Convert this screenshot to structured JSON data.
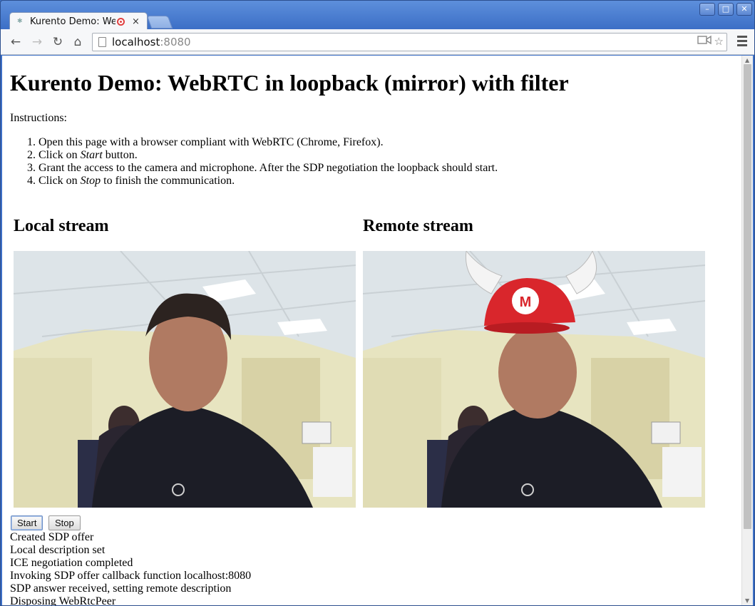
{
  "browser": {
    "tab_title": "Kurento Demo: We",
    "tab_close": "×",
    "url_host": "localhost",
    "url_port": ":8080"
  },
  "page": {
    "heading": "Kurento Demo: WebRTC in loopback (mirror) with filter",
    "instructions_label": "Instructions:",
    "steps": [
      {
        "pre": "Open this page with a browser compliant with WebRTC (Chrome, Firefox).",
        "em": "",
        "post": ""
      },
      {
        "pre": "Click on ",
        "em": "Start",
        "post": " button."
      },
      {
        "pre": "Grant the access to the camera and microphone. After the SDP negotiation the loopback should start.",
        "em": "",
        "post": ""
      },
      {
        "pre": "Click on ",
        "em": "Stop",
        "post": " to finish the communication."
      }
    ],
    "local_stream_heading": "Local stream",
    "remote_stream_heading": "Remote stream",
    "start_label": "Start",
    "stop_label": "Stop",
    "log": [
      "Created SDP offer",
      "Local description set",
      "ICE negotiation completed",
      "Invoking SDP offer callback function localhost:8080",
      "SDP answer received, setting remote description",
      "Disposing WebRtcPeer"
    ]
  },
  "colors": {
    "hat_red": "#d9262c",
    "wall": "#e8e6c2",
    "ceiling": "#dfe6ea",
    "shirt": "#1c1d26",
    "skin": "#b07a62"
  },
  "icons": [
    "page-icon",
    "back-icon",
    "forward-icon",
    "reload-icon",
    "home-icon",
    "camera-icon",
    "star-icon",
    "menu-icon",
    "recording-icon"
  ]
}
